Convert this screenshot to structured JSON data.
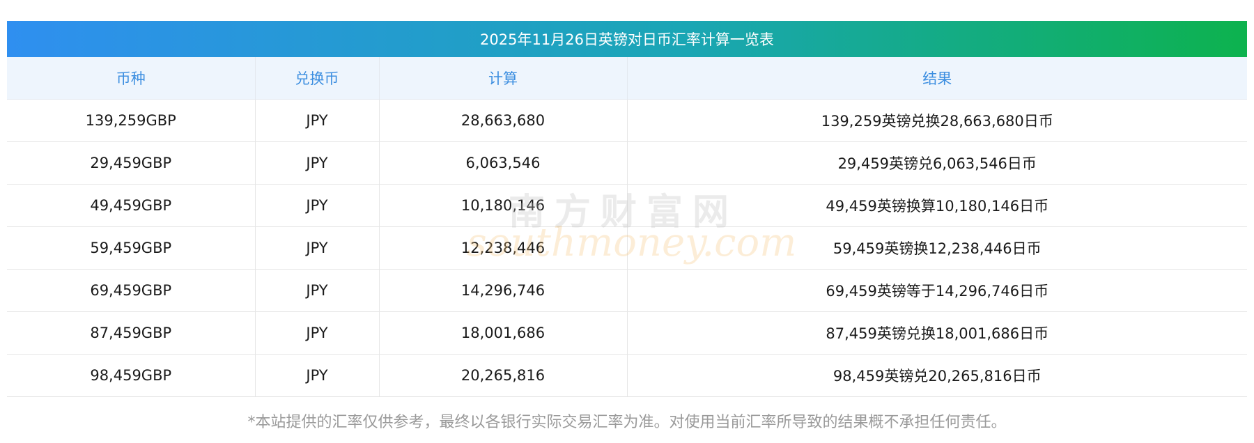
{
  "title": "2025年11月26日英镑对日币汇率计算一览表",
  "columns": [
    "币种",
    "兑换币",
    "计算",
    "结果"
  ],
  "rows": [
    {
      "currency": "139,259GBP",
      "target": "JPY",
      "calc": "28,663,680",
      "result": "139,259英镑兑换28,663,680日币"
    },
    {
      "currency": "29,459GBP",
      "target": "JPY",
      "calc": "6,063,546",
      "result": "29,459英镑兑6,063,546日币"
    },
    {
      "currency": "49,459GBP",
      "target": "JPY",
      "calc": "10,180,146",
      "result": "49,459英镑换算10,180,146日币"
    },
    {
      "currency": "59,459GBP",
      "target": "JPY",
      "calc": "12,238,446",
      "result": "59,459英镑换12,238,446日币"
    },
    {
      "currency": "69,459GBP",
      "target": "JPY",
      "calc": "14,296,746",
      "result": "69,459英镑等于14,296,746日币"
    },
    {
      "currency": "87,459GBP",
      "target": "JPY",
      "calc": "18,001,686",
      "result": "87,459英镑兑换18,001,686日币"
    },
    {
      "currency": "98,459GBP",
      "target": "JPY",
      "calc": "20,265,816",
      "result": "98,459英镑兑20,265,816日币"
    }
  ],
  "footnote": "*本站提供的汇率仅供参考，最终以各银行实际交易汇率为准。对使用当前汇率所导致的结果概不承担任何责任。",
  "watermark": {
    "cn": "南方财富网",
    "en": "southmoney.com"
  },
  "colors": {
    "header_text": "#3c8ee0",
    "title_start": "#2f8ff0",
    "title_end": "#0db24e",
    "footnote": "#9a9a9a"
  }
}
